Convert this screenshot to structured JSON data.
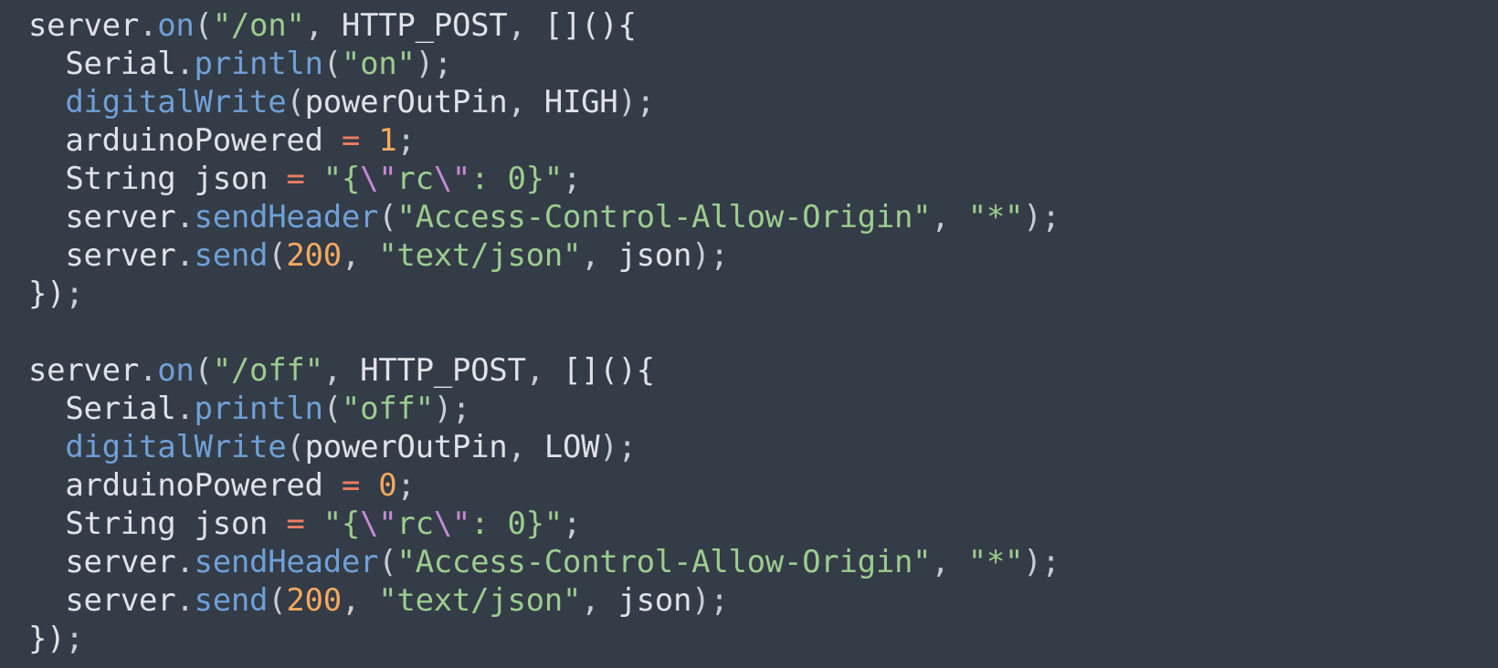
{
  "theme": {
    "background": "#343c47",
    "plain": "#dfe2e7",
    "function": "#6fa0d6",
    "string": "#9ccc8f",
    "number": "#f4a95e",
    "operator": "#ef7d62",
    "punctuation": "#c9cdd3",
    "escape": "#c68ad6"
  },
  "code": {
    "language": "cpp",
    "lines": [
      [
        [
          "plain",
          "server"
        ],
        [
          "punct",
          "."
        ],
        [
          "func",
          "on"
        ],
        [
          "punct",
          "("
        ],
        [
          "str",
          "\"/on\""
        ],
        [
          "punct",
          ", "
        ],
        [
          "plain",
          "HTTP_POST"
        ],
        [
          "punct",
          ", "
        ],
        [
          "plain",
          "[](){"
        ]
      ],
      [
        [
          "plain",
          "  Serial"
        ],
        [
          "punct",
          "."
        ],
        [
          "func",
          "println"
        ],
        [
          "punct",
          "("
        ],
        [
          "str",
          "\"on\""
        ],
        [
          "punct",
          ");"
        ]
      ],
      [
        [
          "plain",
          "  "
        ],
        [
          "func",
          "digitalWrite"
        ],
        [
          "punct",
          "("
        ],
        [
          "plain",
          "powerOutPin"
        ],
        [
          "punct",
          ", "
        ],
        [
          "plain",
          "HIGH"
        ],
        [
          "punct",
          ");"
        ]
      ],
      [
        [
          "plain",
          "  arduinoPowered "
        ],
        [
          "op",
          "="
        ],
        [
          "plain",
          " "
        ],
        [
          "num",
          "1"
        ],
        [
          "punct",
          ";"
        ]
      ],
      [
        [
          "plain",
          "  String json "
        ],
        [
          "op",
          "="
        ],
        [
          "plain",
          " "
        ],
        [
          "str",
          "\"{"
        ],
        [
          "esc",
          "\\\""
        ],
        [
          "str",
          "rc"
        ],
        [
          "esc",
          "\\\""
        ],
        [
          "str",
          ": 0}\""
        ],
        [
          "punct",
          ";"
        ]
      ],
      [
        [
          "plain",
          "  server"
        ],
        [
          "punct",
          "."
        ],
        [
          "func",
          "sendHeader"
        ],
        [
          "punct",
          "("
        ],
        [
          "str",
          "\"Access-Control-Allow-Origin\""
        ],
        [
          "punct",
          ", "
        ],
        [
          "str",
          "\"*\""
        ],
        [
          "punct",
          ");"
        ]
      ],
      [
        [
          "plain",
          "  server"
        ],
        [
          "punct",
          "."
        ],
        [
          "func",
          "send"
        ],
        [
          "punct",
          "("
        ],
        [
          "num",
          "200"
        ],
        [
          "punct",
          ", "
        ],
        [
          "str",
          "\"text/json\""
        ],
        [
          "punct",
          ", "
        ],
        [
          "plain",
          "json"
        ],
        [
          "punct",
          ");"
        ]
      ],
      [
        [
          "plain",
          "})"
        ],
        [
          "punct",
          ";"
        ]
      ],
      [],
      [
        [
          "plain",
          "server"
        ],
        [
          "punct",
          "."
        ],
        [
          "func",
          "on"
        ],
        [
          "punct",
          "("
        ],
        [
          "str",
          "\"/off\""
        ],
        [
          "punct",
          ", "
        ],
        [
          "plain",
          "HTTP_POST"
        ],
        [
          "punct",
          ", "
        ],
        [
          "plain",
          "[](){"
        ]
      ],
      [
        [
          "plain",
          "  Serial"
        ],
        [
          "punct",
          "."
        ],
        [
          "func",
          "println"
        ],
        [
          "punct",
          "("
        ],
        [
          "str",
          "\"off\""
        ],
        [
          "punct",
          ");"
        ]
      ],
      [
        [
          "plain",
          "  "
        ],
        [
          "func",
          "digitalWrite"
        ],
        [
          "punct",
          "("
        ],
        [
          "plain",
          "powerOutPin"
        ],
        [
          "punct",
          ", "
        ],
        [
          "plain",
          "LOW"
        ],
        [
          "punct",
          ");"
        ]
      ],
      [
        [
          "plain",
          "  arduinoPowered "
        ],
        [
          "op",
          "="
        ],
        [
          "plain",
          " "
        ],
        [
          "num",
          "0"
        ],
        [
          "punct",
          ";"
        ]
      ],
      [
        [
          "plain",
          "  String json "
        ],
        [
          "op",
          "="
        ],
        [
          "plain",
          " "
        ],
        [
          "str",
          "\"{"
        ],
        [
          "esc",
          "\\\""
        ],
        [
          "str",
          "rc"
        ],
        [
          "esc",
          "\\\""
        ],
        [
          "str",
          ": 0}\""
        ],
        [
          "punct",
          ";"
        ]
      ],
      [
        [
          "plain",
          "  server"
        ],
        [
          "punct",
          "."
        ],
        [
          "func",
          "sendHeader"
        ],
        [
          "punct",
          "("
        ],
        [
          "str",
          "\"Access-Control-Allow-Origin\""
        ],
        [
          "punct",
          ", "
        ],
        [
          "str",
          "\"*\""
        ],
        [
          "punct",
          ");"
        ]
      ],
      [
        [
          "plain",
          "  server"
        ],
        [
          "punct",
          "."
        ],
        [
          "func",
          "send"
        ],
        [
          "punct",
          "("
        ],
        [
          "num",
          "200"
        ],
        [
          "punct",
          ", "
        ],
        [
          "str",
          "\"text/json\""
        ],
        [
          "punct",
          ", "
        ],
        [
          "plain",
          "json"
        ],
        [
          "punct",
          ");"
        ]
      ],
      [
        [
          "plain",
          "})"
        ],
        [
          "punct",
          ";"
        ]
      ]
    ]
  }
}
